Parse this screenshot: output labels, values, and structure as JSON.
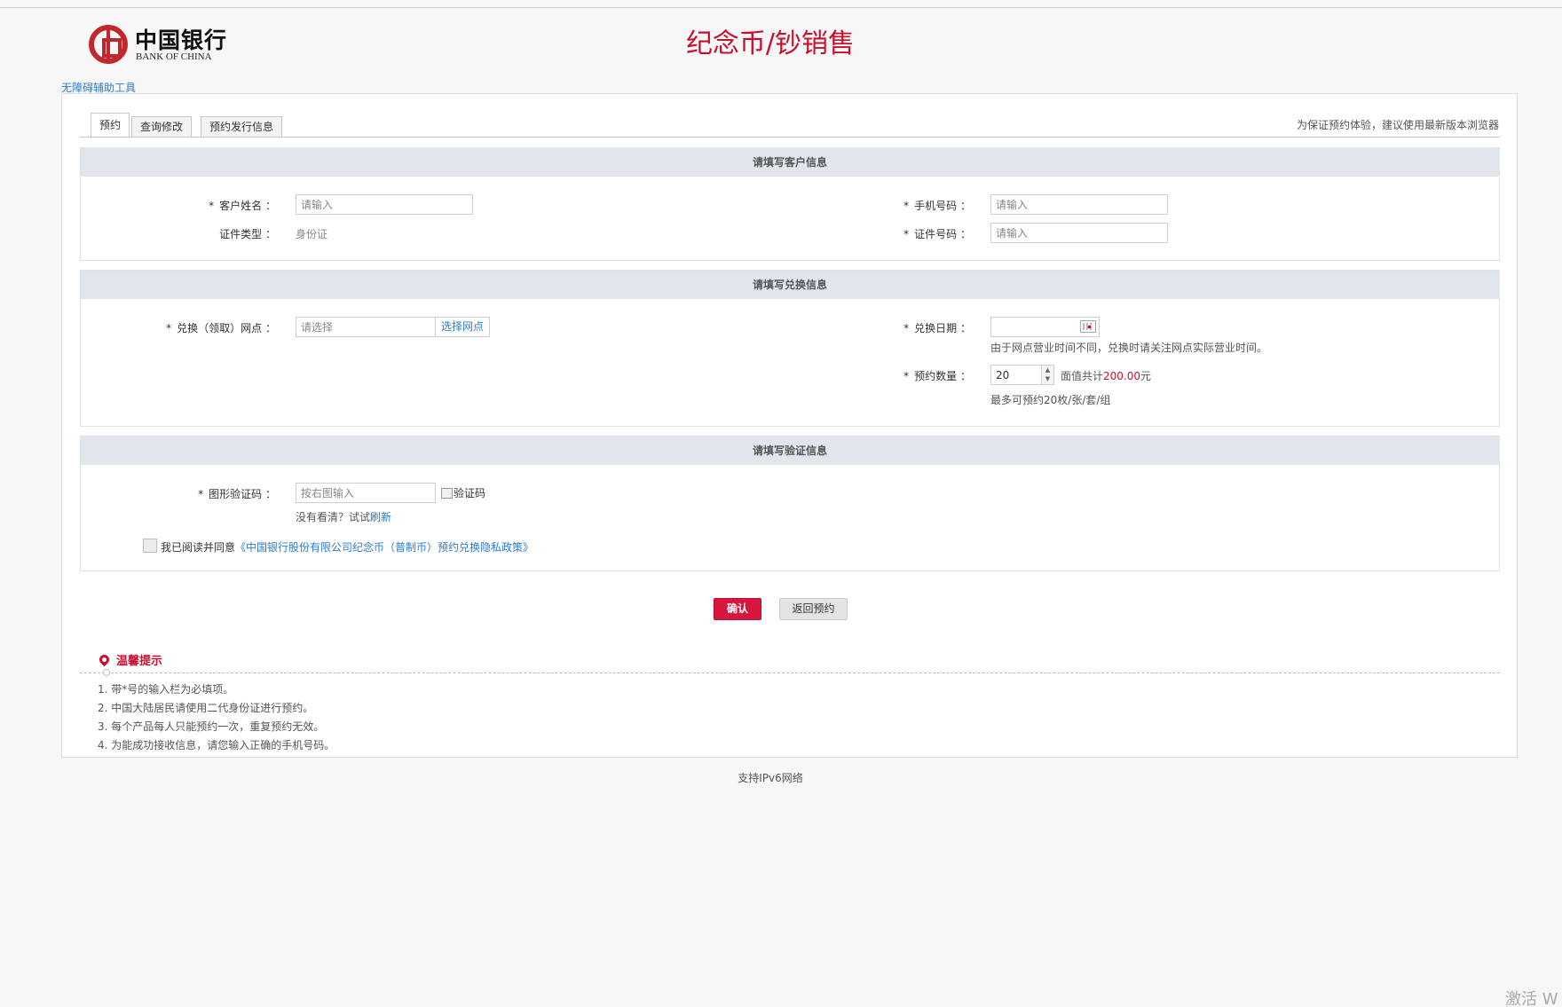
{
  "header": {
    "logo_cn": "中国银行",
    "logo_en": "BANK OF CHINA",
    "title": "纪念币/钞销售",
    "accessibility_link": "无障碍辅助工具"
  },
  "tabs": [
    {
      "label": "预约",
      "active": true
    },
    {
      "label": "查询修改",
      "active": false
    },
    {
      "label": "预约发行信息",
      "active": false
    }
  ],
  "browser_tip": "为保证预约体验，建议使用最新版本浏览器",
  "customer_section": {
    "heading": "请填写客户信息",
    "name_label": "客户姓名",
    "name_placeholder": "请输入",
    "phone_label": "手机号码",
    "phone_placeholder": "请输入",
    "id_type_label": "证件类型",
    "id_type_value": "身份证",
    "id_number_label": "证件号码",
    "id_number_placeholder": "请输入"
  },
  "exchange_section": {
    "heading": "请填写兑换信息",
    "branch_label": "兑换（领取）网点",
    "branch_placeholder": "请选择",
    "branch_button": "选择网点",
    "date_label": "兑换日期",
    "date_hint": "由于网点营业时间不同，兑换时请关注网点实际营业时间。",
    "quantity_label": "预约数量",
    "quantity_value": "20",
    "face_value_prefix": "面值共计",
    "face_value_amount": "200.00",
    "face_value_suffix": "元",
    "quantity_hint": "最多可预约20枚/张/套/组"
  },
  "verify_section": {
    "heading": "请填写验证信息",
    "captcha_label": "图形验证码",
    "captcha_placeholder": "按右图输入",
    "captcha_alt": "验证码",
    "refresh_prefix": "没有看清？试试",
    "refresh_link": "刷新",
    "agree_text": "我已阅读并同意",
    "policy_link": "《中国银行股份有限公司纪念币（普制币）预约兑换隐私政策》"
  },
  "buttons": {
    "confirm": "确认",
    "back": "返回预约"
  },
  "tips": {
    "title": "温馨提示",
    "items": [
      "1. 带*号的输入栏为必填项。",
      "2. 中国大陆居民请使用二代身份证进行预约。",
      "3. 每个产品每人只能预约一次，重复预约无效。",
      "4. 为能成功接收信息，请您输入正确的手机号码。"
    ]
  },
  "footer": "支持IPv6网络",
  "watermark": "激活 W",
  "colors": {
    "brand_red": "#c8102e",
    "link_blue": "#2a7ed1",
    "section_header": "#e0e6ec"
  }
}
